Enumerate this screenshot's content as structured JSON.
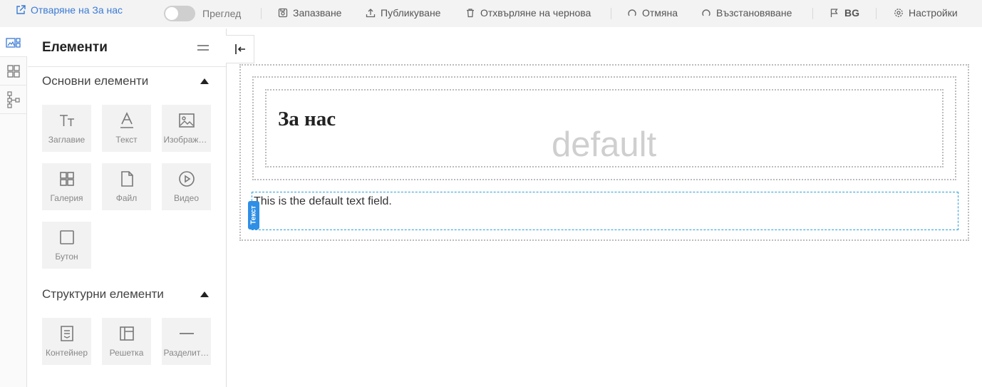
{
  "topbar": {
    "open_page": "Отваряне на За нас",
    "preview": "Преглед",
    "save": "Запазване",
    "publish": "Публикуване",
    "discard_draft": "Отхвърляне на чернова",
    "undo": "Отмяна",
    "redo": "Възстановяване",
    "language": "BG",
    "settings": "Настройки"
  },
  "panel": {
    "title": "Елементи",
    "basic_section": {
      "title": "Основни елементи",
      "items": [
        {
          "label": "Заглавие",
          "icon": "heading-icon"
        },
        {
          "label": "Текст",
          "icon": "text-icon"
        },
        {
          "label": "Изображение",
          "icon": "image-icon"
        },
        {
          "label": "Галерия",
          "icon": "gallery-icon"
        },
        {
          "label": "Файл",
          "icon": "file-icon"
        },
        {
          "label": "Видео",
          "icon": "video-icon"
        },
        {
          "label": "Бутон",
          "icon": "button-icon"
        }
      ]
    },
    "structure_section": {
      "title": "Структурни елементи",
      "items": [
        {
          "label": "Контейнер",
          "icon": "container-icon"
        },
        {
          "label": "Решетка",
          "icon": "grid-icon"
        },
        {
          "label": "Разделител",
          "icon": "divider-icon"
        }
      ]
    }
  },
  "canvas": {
    "heading": "За нас",
    "watermark": "default",
    "text_field": "This is the default text field.",
    "text_tag": "Текст"
  },
  "colors": {
    "accent": "#3a7bd5",
    "selection": "#2a9fd8",
    "tag": "#2f8fe6"
  }
}
